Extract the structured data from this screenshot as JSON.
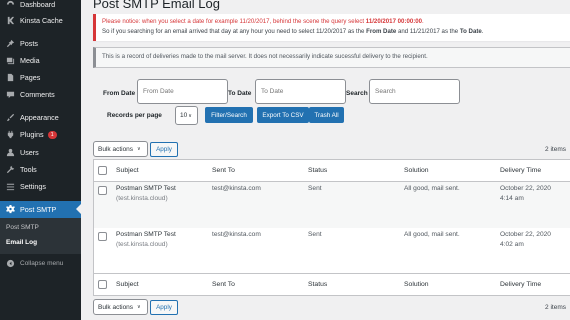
{
  "sidebar": {
    "items": [
      {
        "label": "Dashboard",
        "icon": "dashboard-icon"
      },
      {
        "label": "Kinsta Cache",
        "icon": "kinsta-icon"
      },
      {
        "label": "Posts",
        "icon": "pin-icon"
      },
      {
        "label": "Media",
        "icon": "media-icon"
      },
      {
        "label": "Pages",
        "icon": "page-icon"
      },
      {
        "label": "Comments",
        "icon": "comment-icon"
      },
      {
        "label": "Appearance",
        "icon": "brush-icon"
      },
      {
        "label": "Plugins",
        "icon": "plugin-icon",
        "badge": "1"
      },
      {
        "label": "Users",
        "icon": "user-icon"
      },
      {
        "label": "Tools",
        "icon": "wrench-icon"
      },
      {
        "label": "Settings",
        "icon": "settings-icon"
      },
      {
        "label": "Post SMTP",
        "icon": "gear-icon"
      }
    ],
    "submenu": [
      {
        "label": "Post SMTP"
      },
      {
        "label": "Email Log"
      }
    ],
    "collapse_label": "Collapse menu"
  },
  "page": {
    "title": "Post SMTP Email Log"
  },
  "notice": {
    "line1_prefix": "Please notice: when you select a date for example 11/20/2017, behind the scene the query select ",
    "line1_highlight": "11/20/2017 00:00:00",
    "line1_suffix": ".",
    "line2_prefix": "So if you searching for an email arrived that day at any hour you need to select 11/20/2017 as the ",
    "line2_from": "From Date",
    "line2_mid": " and 11/21/2017 as the ",
    "line2_to": "To Date",
    "line2_suffix": "."
  },
  "info_text": "This is a record of deliveries made to the mail server. It does not necessarily indicate sucessful delivery to the recipient.",
  "filters": {
    "from_label": "From Date",
    "from_placeholder": "From Date",
    "to_label": "To Date",
    "to_placeholder": "To Date",
    "search_label": "Search",
    "search_placeholder": "Search",
    "records_label": "Records per page",
    "records_value": "10",
    "filter_button": "Filter/Search",
    "export_button": "Export To CSV",
    "trash_button": "Trash All"
  },
  "bulk": {
    "select_label": "Bulk actions",
    "apply_label": "Apply",
    "count": "2 items"
  },
  "table": {
    "columns": [
      "Subject",
      "Sent To",
      "Status",
      "Solution",
      "Delivery Time"
    ],
    "rows": [
      {
        "subject": "Postman SMTP Test",
        "subject_sub": "(test.kinsta.cloud)",
        "sent_to": "test@kinsta.com",
        "status": "Sent",
        "solution": "All good, mail sent.",
        "delivery_date": "October 22, 2020",
        "delivery_time": "4:14 am"
      },
      {
        "subject": "Postman SMTP Test",
        "subject_sub": "(test.kinsta.cloud)",
        "sent_to": "test@kinsta.com",
        "status": "Sent",
        "solution": "All good, mail sent.",
        "delivery_date": "October 22, 2020",
        "delivery_time": "4:02 am"
      }
    ]
  },
  "colors": {
    "sidebar_bg": "#1d2327",
    "accent": "#2271b1",
    "notice_border": "#d63638"
  }
}
